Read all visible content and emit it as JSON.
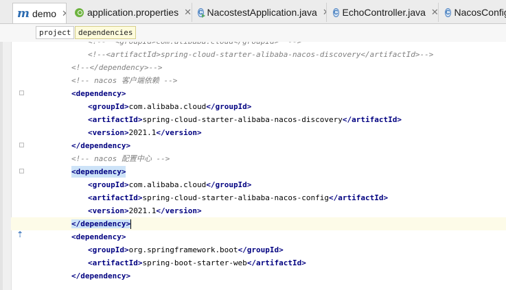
{
  "tabs": [
    {
      "label": "demo",
      "icon": "maven-m-icon",
      "close": "✕",
      "active": true
    },
    {
      "label": "application.properties",
      "icon": "spring-leaf-icon",
      "close": "✕",
      "active": false
    },
    {
      "label": "NacostestApplication.java",
      "icon": "java-run-class-icon",
      "close": "✕",
      "active": false
    },
    {
      "label": "EchoController.java",
      "icon": "java-class-icon",
      "close": "✕",
      "active": false
    },
    {
      "label": "NacosConfig",
      "icon": "java-class-icon",
      "close": "",
      "active": false
    }
  ],
  "icon_letters": {
    "m": "m",
    "c": "C"
  },
  "breadcrumbs": [
    "project",
    "dependencies"
  ],
  "colors": {
    "tag": "#000080",
    "comment": "#808080",
    "caret_line": "#fdfbe8",
    "tag_highlight": "#cde3f8"
  },
  "lines": [
    {
      "id": "l0",
      "cls": "cm",
      "text": "<!--  <groupId>com.alibaba.cloud</groupId>  -->"
    },
    {
      "id": "l1",
      "cls": "cm",
      "text": "<!--<artifactId>spring-cloud-starter-alibaba-nacos-discovery</artifactId>-->"
    },
    {
      "id": "l2",
      "cls": "cm",
      "text": "<!--</dependency>-->"
    },
    {
      "id": "l3",
      "cls": "cm",
      "text": "<!-- nacos 客户端依赖 -->"
    },
    {
      "open": "<dependency>"
    },
    {
      "tag": "groupId",
      "value": "com.alibaba.cloud"
    },
    {
      "tag": "artifactId",
      "value": "spring-cloud-starter-alibaba-nacos-discovery"
    },
    {
      "tag": "version",
      "value": "2021.1"
    },
    {
      "close": "</dependency>"
    },
    {
      "comment": "<!-- nacos 配置中心 -->"
    },
    {
      "open": "<dependency>"
    },
    {
      "tag": "groupId",
      "value": "com.alibaba.cloud"
    },
    {
      "tag": "artifactId",
      "value": "spring-cloud-starter-alibaba-nacos-config"
    },
    {
      "tag": "version",
      "value": "2021.1"
    },
    {
      "close": "</dependency>"
    },
    {
      "open": "<dependency>"
    },
    {
      "tag": "groupId",
      "value": "org.springframework.boot"
    },
    {
      "tag": "artifactId",
      "value": "spring-boot-starter-web"
    },
    {
      "close": "</dependency>"
    }
  ],
  "code": {
    "dep_open": "<dependency>",
    "dep_close": "</dependency>",
    "groupId_open": "<groupId>",
    "groupId_close": "</groupId>",
    "artifactId_open": "<artifactId>",
    "artifactId_close": "</artifactId>",
    "version_open": "<version>",
    "version_close": "</version>",
    "comment0": "<!--  <groupId>com.alibaba.cloud</groupId>  -->",
    "comment1": "<!--<artifactId>spring-cloud-starter-alibaba-nacos-discovery</artifactId>-->",
    "comment2": "<!--</dependency>-->",
    "comment3": "<!-- nacos 客户端依赖 -->",
    "comment4": "<!-- nacos 配置中心 -->",
    "v_groupId1": "com.alibaba.cloud",
    "v_artifact1": "spring-cloud-starter-alibaba-nacos-discovery",
    "v_version1": "2021.1",
    "v_groupId2": "com.alibaba.cloud",
    "v_artifact2": "spring-cloud-starter-alibaba-nacos-config",
    "v_version2": "2021.1",
    "v_groupId3": "org.springframework.boot",
    "v_artifact3": "spring-boot-starter-web"
  },
  "gutter_icon": "implemented-arrow-icon",
  "gutter_glyph": "⇡"
}
